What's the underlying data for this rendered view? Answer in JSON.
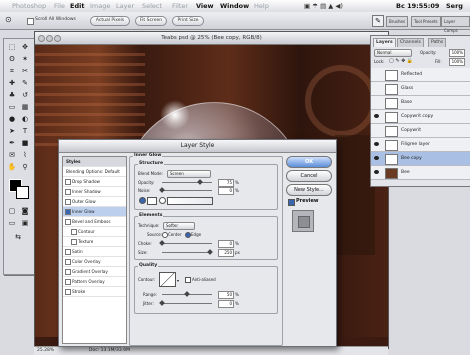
{
  "menubar": {
    "apple": "",
    "items": [
      "Photoshop",
      "File",
      "Edit",
      "Image",
      "Layer",
      "Select",
      "Filter",
      "View",
      "Window",
      "Help"
    ],
    "clock": "Bc 19:55:09",
    "user": "Serg"
  },
  "options_bar": {
    "checkbox_label": "Scroll All Windows",
    "buttons": [
      "Actual Pixels",
      "Fit Screen",
      "Print Size"
    ],
    "palette_tabs": [
      "Brushes",
      "Tool Presets",
      "Layer Comps"
    ]
  },
  "document": {
    "title": "Teabs psd @ 25% (Bee copy, RGB/8)",
    "status_zoom": "25.28%",
    "status_doc": "Doc: 13.1M/33.6M"
  },
  "layers_palette": {
    "tabs": [
      "Layers",
      "Channels",
      "Paths"
    ],
    "blend_mode": "Normal",
    "opacity_label": "Opacity:",
    "opacity_value": "100%",
    "lock_label": "Lock:",
    "fill_label": "Fill:",
    "fill_value": "100%",
    "rows": [
      {
        "name": "Reflected",
        "selected": false,
        "eye": false
      },
      {
        "name": "Glass",
        "selected": false,
        "eye": false
      },
      {
        "name": "Base",
        "selected": false,
        "eye": false
      },
      {
        "name": "Copywrit copy",
        "selected": false,
        "eye": true
      },
      {
        "name": "Copywrit",
        "selected": false,
        "eye": false
      },
      {
        "name": "Filigree layer",
        "selected": false,
        "eye": true
      },
      {
        "name": "Bee copy",
        "selected": true,
        "eye": true
      },
      {
        "name": "Bee",
        "selected": false,
        "eye": true
      }
    ]
  },
  "dialog": {
    "title": "Layer Style",
    "styles": [
      {
        "label": "Styles",
        "checked": false,
        "head": true,
        "sub": false,
        "selected": false
      },
      {
        "label": "Blending Options: Default",
        "checked": false,
        "head": false,
        "sub": false,
        "selected": false
      },
      {
        "label": "Drop Shadow",
        "checked": false,
        "head": false,
        "sub": false,
        "selected": false
      },
      {
        "label": "Inner Shadow",
        "checked": false,
        "head": false,
        "sub": false,
        "selected": false
      },
      {
        "label": "Outer Glow",
        "checked": false,
        "head": false,
        "sub": false,
        "selected": false
      },
      {
        "label": "Inner Glow",
        "checked": true,
        "head": false,
        "sub": false,
        "selected": true
      },
      {
        "label": "Bevel and Emboss",
        "checked": false,
        "head": false,
        "sub": false,
        "selected": false
      },
      {
        "label": "Contour",
        "checked": false,
        "head": false,
        "sub": true,
        "selected": false
      },
      {
        "label": "Texture",
        "checked": false,
        "head": false,
        "sub": true,
        "selected": false
      },
      {
        "label": "Satin",
        "checked": false,
        "head": false,
        "sub": false,
        "selected": false
      },
      {
        "label": "Color Overlay",
        "checked": false,
        "head": false,
        "sub": false,
        "selected": false
      },
      {
        "label": "Gradient Overlay",
        "checked": false,
        "head": false,
        "sub": false,
        "selected": false
      },
      {
        "label": "Pattern Overlay",
        "checked": false,
        "head": false,
        "sub": false,
        "selected": false
      },
      {
        "label": "Stroke",
        "checked": false,
        "head": false,
        "sub": false,
        "selected": false
      }
    ],
    "inner_glow": {
      "heading": "Inner Glow",
      "structure_label": "Structure",
      "blend_mode_label": "Blend Mode:",
      "blend_mode_value": "Screen",
      "opacity_label": "Opacity:",
      "opacity_value": "75",
      "opacity_level": 0.75,
      "noise_label": "Noise:",
      "noise_value": "0",
      "noise_level": 0.0,
      "percent": "%",
      "elements_label": "Elements",
      "technique_label": "Technique:",
      "technique_value": "Softer",
      "source_label": "Source:",
      "source_center": "Center",
      "source_edge": "Edge",
      "choke_label": "Choke:",
      "choke_value": "0",
      "choke_level": 0.0,
      "size_label": "Size:",
      "size_value": "250",
      "size_level": 0.95,
      "px": "px",
      "quality_label": "Quality",
      "contour_label": "Contour:",
      "anti_aliased_label": "Anti-aliased",
      "range_label": "Range:",
      "range_value": "50",
      "range_level": 0.5,
      "jitter_label": "Jitter:",
      "jitter_value": "0",
      "jitter_level": 0.0
    },
    "buttons": {
      "ok": "OK",
      "cancel": "Cancel",
      "new_style": "New Style...",
      "preview": "Preview"
    }
  }
}
